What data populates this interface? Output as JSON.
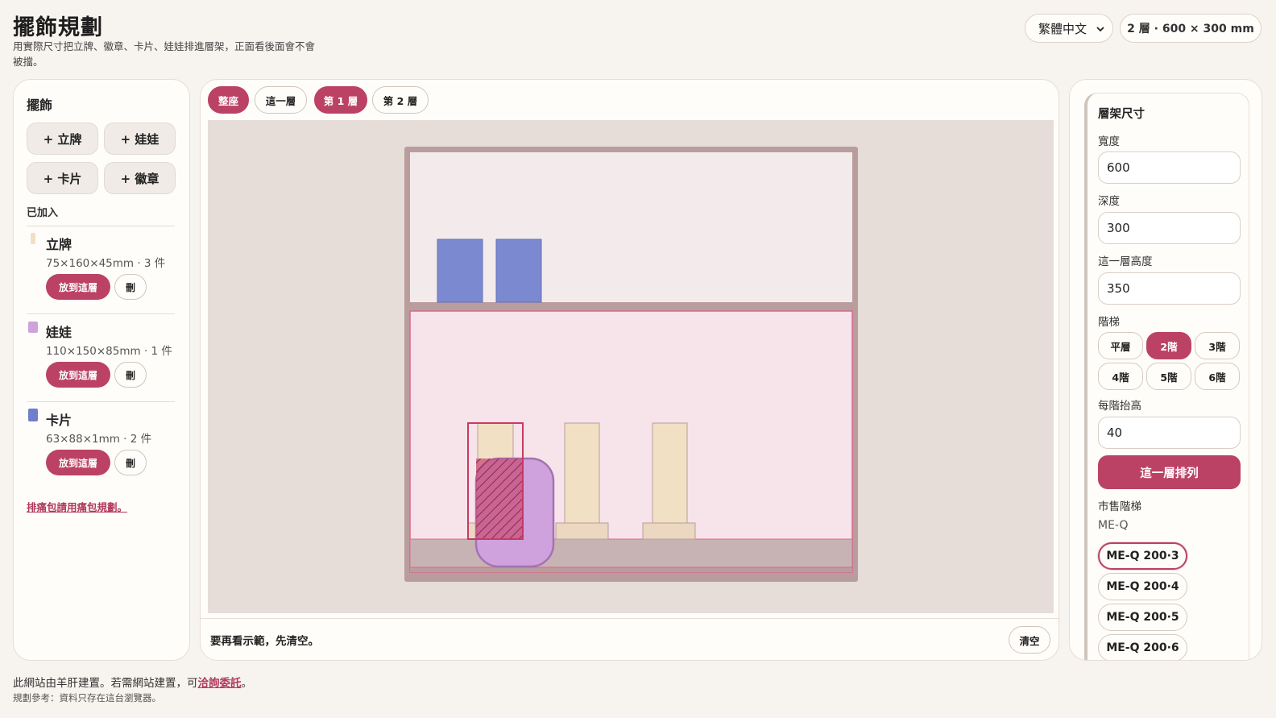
{
  "header": {
    "title": "擺飾規劃",
    "subtitle": "用實際尺寸把立牌、徽章、卡片、娃娃排進層架，正面看後面會不會被擋。",
    "language": "繁體中文",
    "dimensions": "2 層 · 600 × 300 mm"
  },
  "left": {
    "heading": "擺飾",
    "add_buttons": [
      "+ 立牌",
      "+ 娃娃",
      "+ 卡片",
      "+ 徽章"
    ],
    "added_label": "已加入",
    "items": [
      {
        "name": "立牌",
        "meta": "75×160×45mm · 3 件",
        "color": "#f2e0c4",
        "place": "放到這層",
        "delete": "刪"
      },
      {
        "name": "娃娃",
        "meta": "110×150×85mm · 1 件",
        "color": "#cfa2dd",
        "place": "放到這層",
        "delete": "刪"
      },
      {
        "name": "卡片",
        "meta": "63×88×1mm · 2 件",
        "color": "#6f7fcc",
        "place": "放到這層",
        "delete": "刪"
      }
    ],
    "pain_link": "排痛包請用痛包規劃。"
  },
  "center": {
    "tabs": [
      "整座",
      "這一層",
      "第 1 層",
      "第 2 層"
    ],
    "active_tabs": [
      "整座",
      "第 1 層"
    ],
    "footer_message": "要再看示範，先清空。",
    "clear_label": "清空"
  },
  "right": {
    "heading": "層架尺寸",
    "width_label": "寬度",
    "width_value": "600",
    "depth_label": "深度",
    "depth_value": "300",
    "layer_height_label": "這一層高度",
    "layer_height_value": "350",
    "steps_label": "階梯",
    "steps": [
      "平層",
      "2階",
      "3階",
      "4階",
      "5階",
      "6階"
    ],
    "active_step": "2階",
    "rise_label": "每階抬高",
    "rise_value": "40",
    "arrange_label": "這一層排列",
    "retail_label": "市售階梯",
    "brand": "ME-Q",
    "models": [
      "ME-Q 200·3",
      "ME-Q 200·4",
      "ME-Q 200·5",
      "ME-Q 200·6"
    ],
    "active_model": "ME-Q 200·3"
  },
  "footer": {
    "text": "此網站由羊肝建置。若需網站建置，可",
    "link": "洽詢委託",
    "end": "。",
    "note": "規劃參考：資料只存在這台瀏覽器。"
  },
  "colors": {
    "accent": "#bb4265",
    "shelf_frame": "#b89c9a",
    "card_blue": "#7b8ad0",
    "standee": "#f2e0c4",
    "doll": "#cfa2dd",
    "active_layer": "#f7e3ea",
    "upper_layer": "#f3ebeb",
    "step": "#c7b3b3"
  }
}
